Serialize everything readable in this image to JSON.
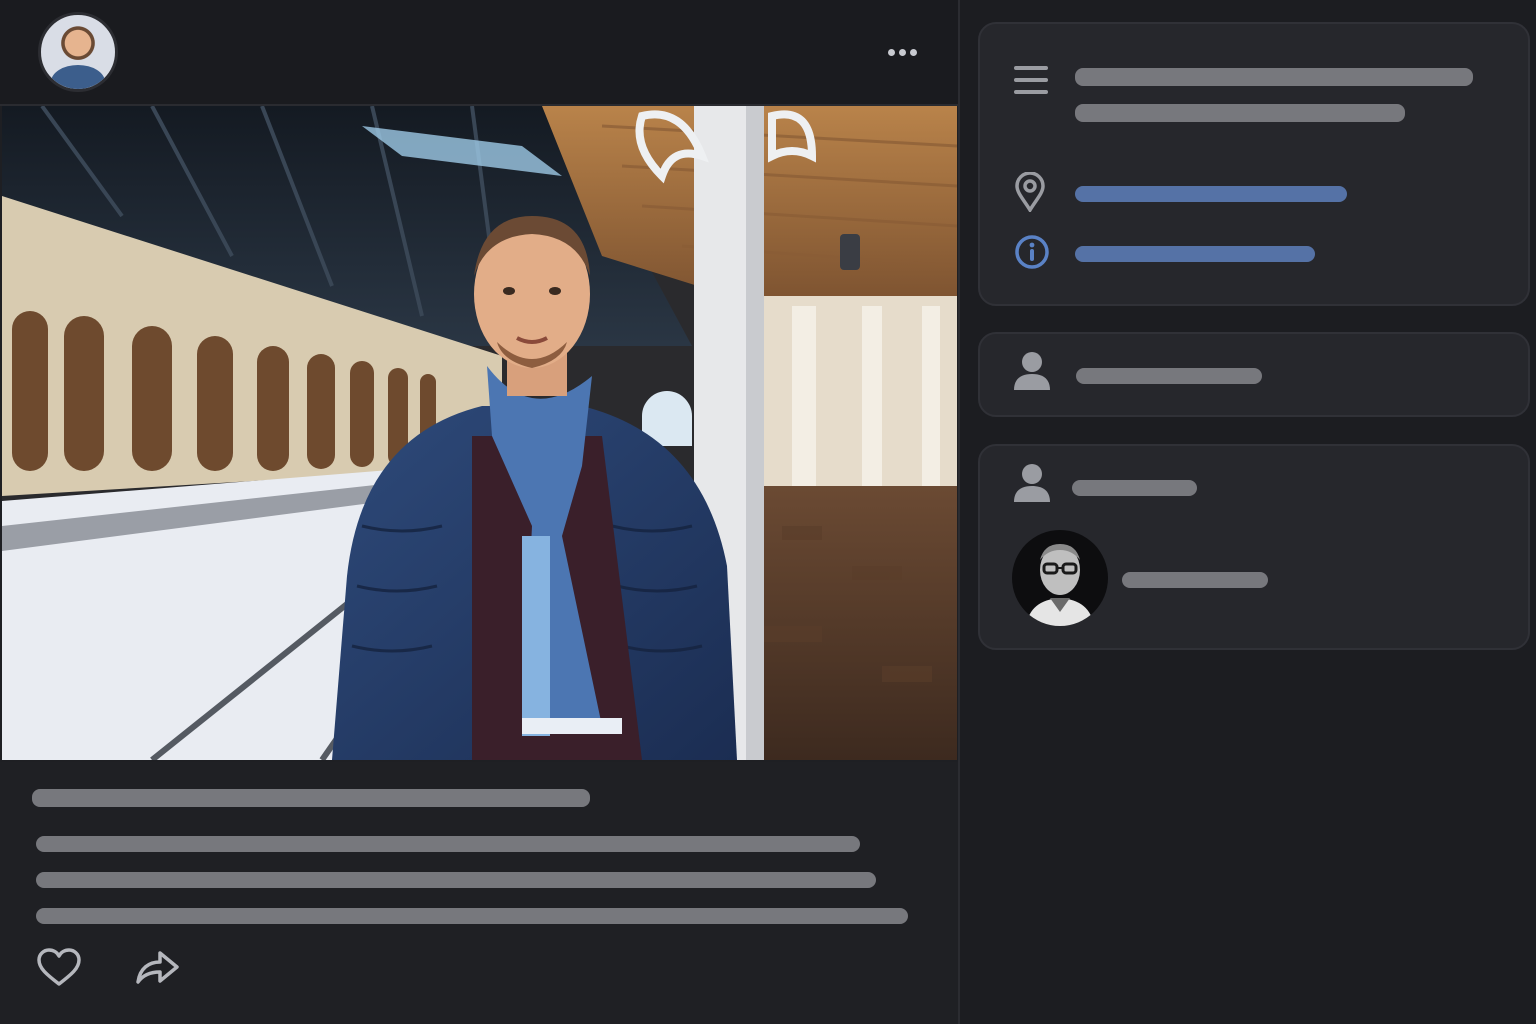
{
  "post": {
    "author_avatar": "author-avatar",
    "menu_icon": "more-horizontal-icon",
    "photo_alt": "",
    "actions": {
      "like_icon": "heart-icon",
      "share_icon": "share-arrow-icon"
    }
  },
  "sidebar": {
    "details": {
      "list_icon": "menu-lines-icon",
      "location_icon": "map-pin-icon",
      "info_icon": "info-circle-icon"
    },
    "people": {
      "person_icon": "user-icon"
    },
    "tagged": {
      "person_icon": "user-icon",
      "avatar": "tagged-user-avatar"
    }
  },
  "colors": {
    "background": "#1c1d21",
    "panel": "#26272c",
    "placeholder": "#77787d",
    "accent_blue": "#5572a6"
  }
}
